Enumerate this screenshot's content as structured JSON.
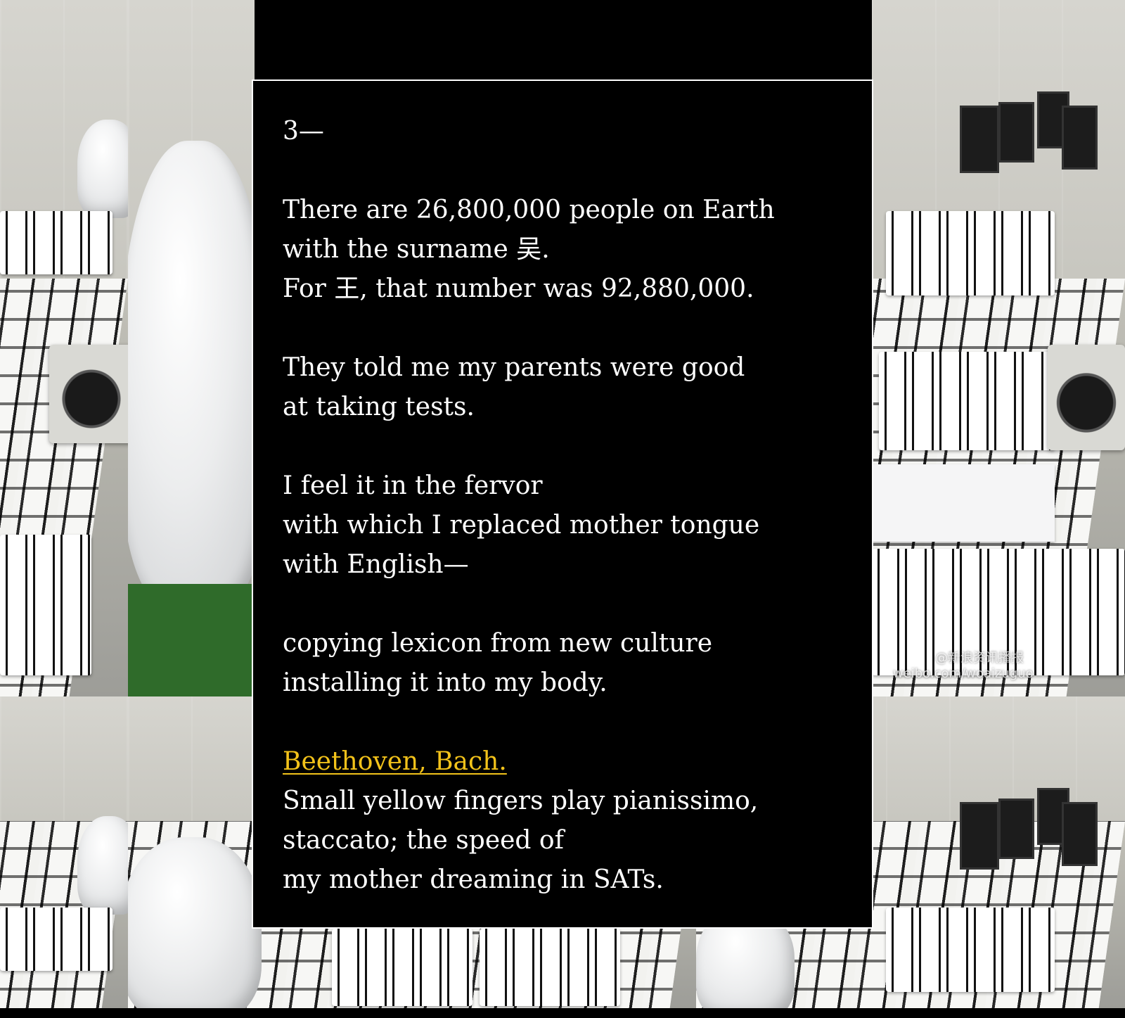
{
  "background": {
    "description_icon": "factory-cleanroom-photo",
    "watermark_line1": "@新浪资讯播报",
    "watermark_line2": "weibo.com/woaizuguo"
  },
  "poem": {
    "section_number": "3—",
    "stanzas": [
      {
        "lines": [
          "There are 26,800,000 people on Earth",
          "with the surname 吴.",
          "For 王, that number was 92,880,000."
        ]
      },
      {
        "lines": [
          "They told me my parents were good",
          "at taking tests."
        ]
      },
      {
        "lines": [
          "I feel it in the fervor",
          "with which I replaced mother tongue",
          "with English—"
        ]
      },
      {
        "lines": [
          "copying lexicon from new culture",
          "installing it into my body."
        ]
      },
      {
        "link_text": "Beethoven, Bach.",
        "lines": [
          "Small yellow fingers play pianissimo,",
          "staccato; the speed of",
          "my mother dreaming in SATs."
        ]
      }
    ],
    "colors": {
      "card_background": "#000000",
      "text": "#ffffff",
      "link": "#f2c21a",
      "border": "#ffffff"
    }
  }
}
